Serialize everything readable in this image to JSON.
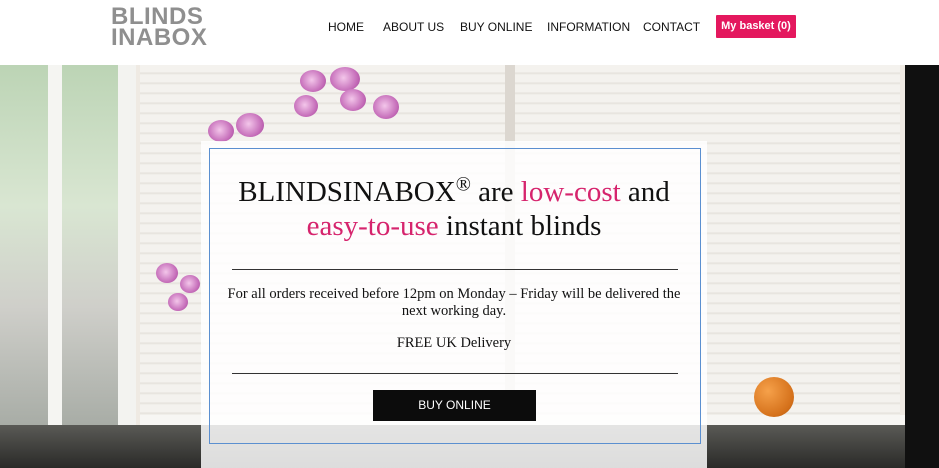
{
  "header": {
    "logo_line1": "BLINDS",
    "logo_line2": "INABOX",
    "nav": [
      "HOME",
      "ABOUT US",
      "BUY ONLINE",
      "INFORMATION",
      "CONTACT"
    ],
    "basket_label": "My basket (0)"
  },
  "promo": {
    "headline_part1": "BLINDSINABOX",
    "headline_reg": "®",
    "headline_part2": " are ",
    "headline_pink1": "low-cost",
    "headline_part3": " and",
    "headline_pink2": "easy-to-use",
    "headline_part4": " instant blinds",
    "orders_text": "For all orders received before 12pm on Monday – Friday will be delivered the next working day.",
    "delivery_text": "FREE UK Delivery",
    "cta_label": "BUY ONLINE"
  },
  "colors": {
    "accent": "#e4185e",
    "accent_text": "#d6246d",
    "cta_background": "#0c0c0c",
    "panel_border": "#5b8fd0"
  }
}
